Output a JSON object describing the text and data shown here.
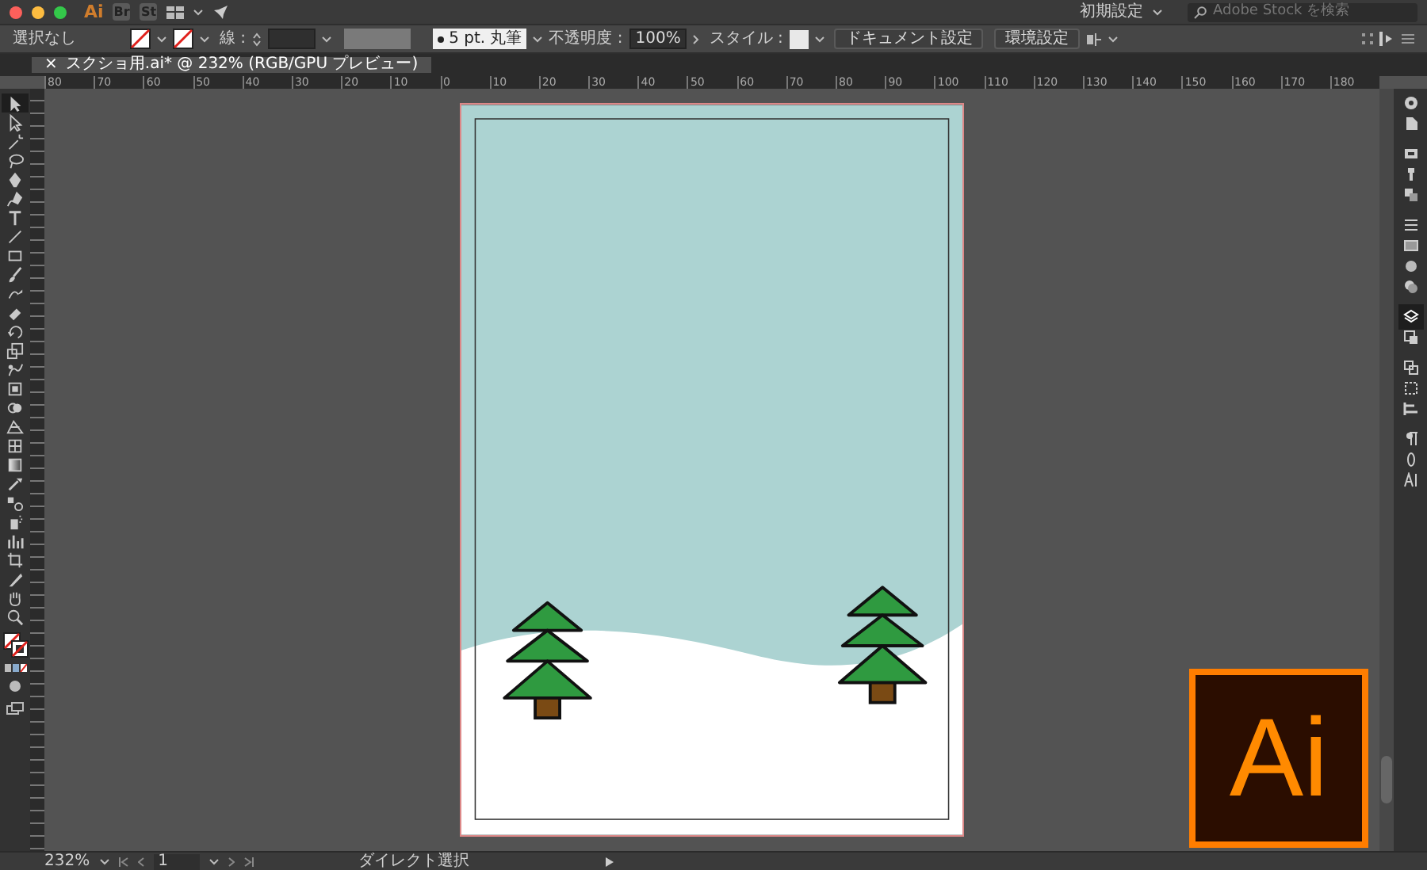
{
  "title_bar": {
    "app_logo": "Ai",
    "apps": [
      "Br",
      "St"
    ],
    "workspace": "初期設定",
    "search": {
      "placeholder": "Adobe Stock を検索"
    }
  },
  "control_bar": {
    "selection": "選択なし",
    "stroke_label": "線 :",
    "brush": "5 pt. 丸筆",
    "opacity_label": "不透明度 :",
    "opacity": "100%",
    "style_label": "スタイル :",
    "buttons": [
      "ドキュメント設定",
      "環境設定"
    ]
  },
  "tabs": [
    {
      "close": "×",
      "label": "スクショ用.ai* @ 232% (RGB/GPU プレビュー)",
      "selected": true
    }
  ],
  "ruler": {
    "labels": [
      "80",
      "70",
      "60",
      "50",
      "40",
      "30",
      "20",
      "10",
      "0",
      "10",
      "20",
      "30",
      "40",
      "50",
      "60",
      "70",
      "80",
      "90",
      "100",
      "110",
      "120",
      "130",
      "140",
      "150",
      "160",
      "170",
      "180"
    ]
  },
  "tools": [
    {
      "kind": "selection",
      "selected": true
    },
    {
      "kind": "direct",
      "selected": false
    },
    {
      "kind": "wand",
      "selected": false
    },
    {
      "kind": "lasso",
      "selected": false
    },
    {
      "kind": "pen",
      "selected": false
    },
    {
      "kind": "curvature",
      "selected": false
    },
    {
      "kind": "type",
      "selected": false
    },
    {
      "kind": "line",
      "selected": false
    },
    {
      "kind": "rectangle",
      "selected": false
    },
    {
      "kind": "brush",
      "selected": false
    },
    {
      "kind": "shaper",
      "selected": false
    },
    {
      "kind": "eraser",
      "selected": false
    },
    {
      "kind": "rotate",
      "selected": false
    },
    {
      "kind": "scale",
      "selected": false
    },
    {
      "kind": "warp",
      "selected": false
    },
    {
      "kind": "transform",
      "selected": false
    },
    {
      "kind": "builder",
      "selected": false
    },
    {
      "kind": "perspective",
      "selected": false
    },
    {
      "kind": "mesh",
      "selected": false
    },
    {
      "kind": "gradient",
      "selected": false
    },
    {
      "kind": "eyedropper",
      "selected": false
    },
    {
      "kind": "blend",
      "selected": false
    },
    {
      "kind": "spray",
      "selected": false
    },
    {
      "kind": "graph",
      "selected": false
    },
    {
      "kind": "artboard",
      "selected": false
    },
    {
      "kind": "slice",
      "selected": false
    },
    {
      "kind": "hand",
      "selected": false
    },
    {
      "kind": "zoom",
      "selected": false
    }
  ],
  "status_bar": {
    "zoom": "232%",
    "artboard": "1",
    "tool": "ダイレクト選択"
  },
  "logo_badge": "Ai"
}
